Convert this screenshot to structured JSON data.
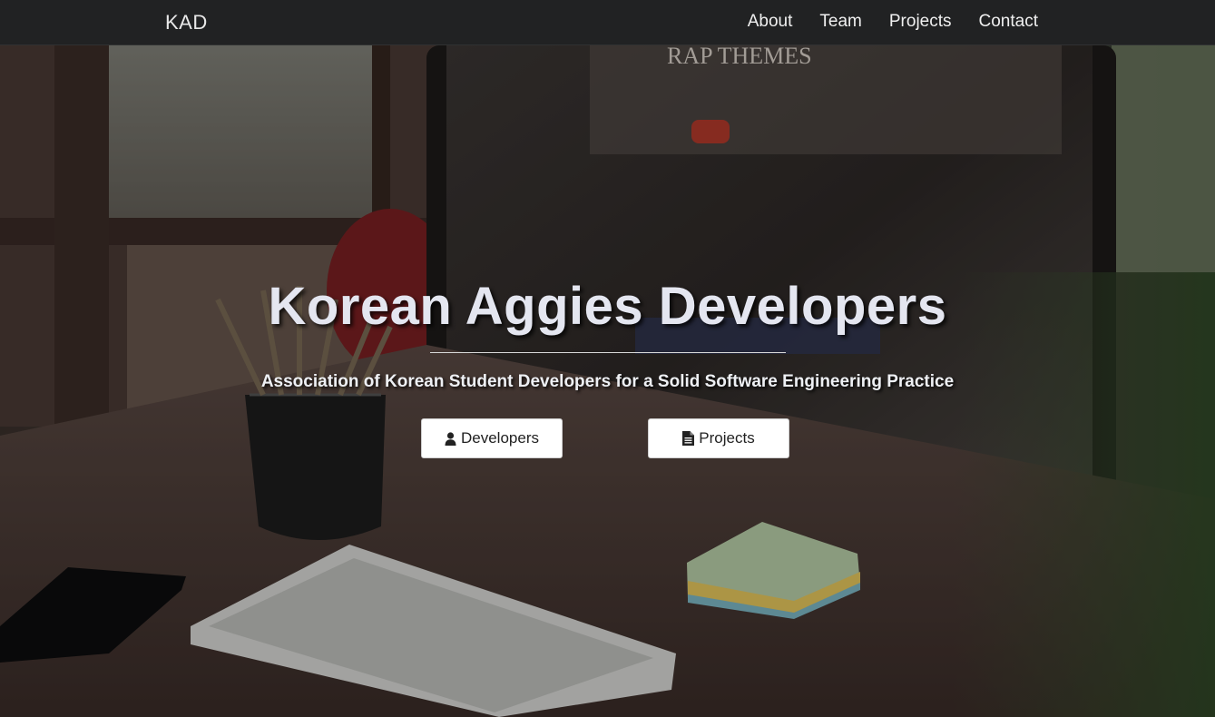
{
  "navbar": {
    "brand": "KAD",
    "links": [
      {
        "label": "About"
      },
      {
        "label": "Team"
      },
      {
        "label": "Projects"
      },
      {
        "label": "Contact"
      }
    ]
  },
  "hero": {
    "title": "Korean Aggies Developers",
    "subtitle": "Association of Korean Student Developers for a Solid Software Engineering Practice",
    "buttons": [
      {
        "label": "Developers",
        "icon": "user-icon"
      },
      {
        "label": "Projects",
        "icon": "file-icon"
      }
    ],
    "background_text": "RAP THEMES"
  }
}
